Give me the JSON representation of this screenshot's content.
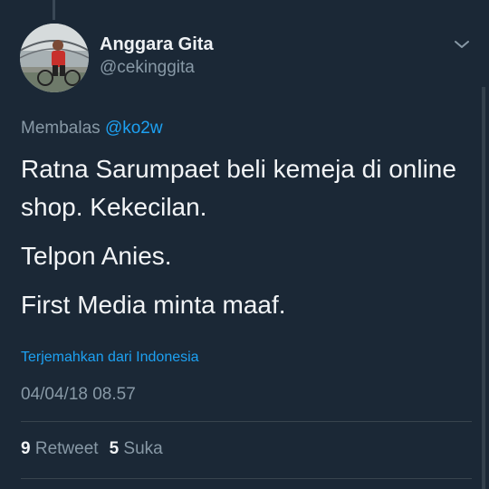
{
  "tweet": {
    "author": {
      "name": "Anggara Gita",
      "handle": "@cekinggita",
      "avatar_icon": "profile-photo-cyclist"
    },
    "menu_icon": "chevron-down-icon",
    "replying_to": {
      "label": "Membalas",
      "mention": "@ko2w"
    },
    "body": {
      "line1": "Ratna Sarumpaet beli kemeja di online shop. Kekecilan.",
      "line2": "Telpon Anies.",
      "line3": "First Media minta maaf."
    },
    "translate_label": "Terjemahkan dari Indonesia",
    "timestamp": "04/04/18 08.57",
    "stats": {
      "retweets_count": "9",
      "retweets_label": "Retweet",
      "likes_count": "5",
      "likes_label": "Suka"
    }
  },
  "colors": {
    "background": "#1b2836",
    "accent": "#1da1f2",
    "muted": "#8899a6",
    "text": "#f2f4f6",
    "divider": "#38444d"
  }
}
